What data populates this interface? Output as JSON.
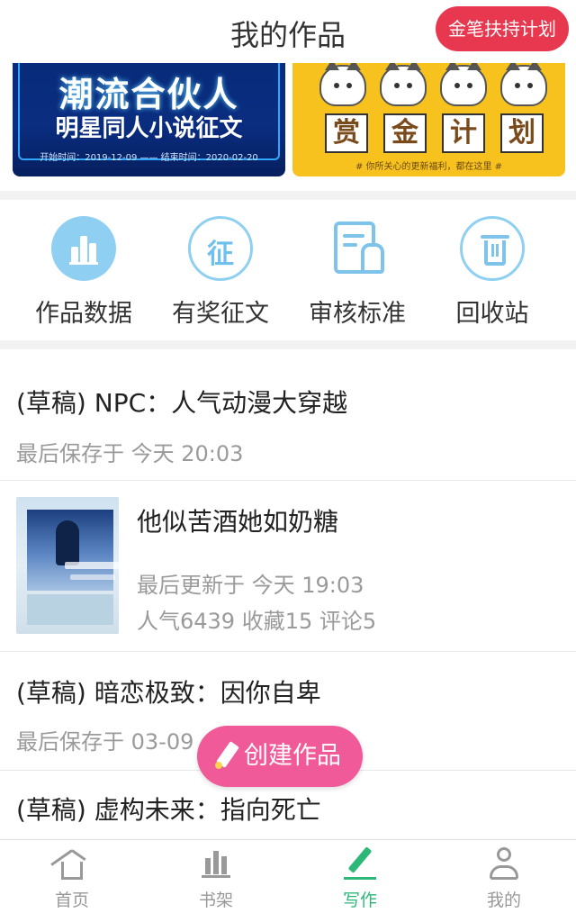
{
  "header": {
    "title": "我的作品",
    "jinbi_label": "金笔扶持计划"
  },
  "banners": [
    {
      "title": "潮流合伙人",
      "subtitle": "明星同人小说征文",
      "dates": "开始时间：2019-12-09 —— 结束时间：2020-02-20"
    },
    {
      "chars": [
        "赏",
        "金",
        "计",
        "划"
      ],
      "subtitle": "# 你所关心的更新福利，都在这里 #"
    }
  ],
  "quick": [
    {
      "label": "作品数据",
      "icon": "bar-chart-icon"
    },
    {
      "label": "有奖征文",
      "icon": "contest-icon",
      "glyph": "征"
    },
    {
      "label": "审核标准",
      "icon": "review-standard-icon"
    },
    {
      "label": "回收站",
      "icon": "trash-icon"
    }
  ],
  "works": [
    {
      "title": "(草稿) NPC：人气动漫大穿越",
      "meta": "最后保存于 今天 20:03"
    },
    {
      "title": "他似苦酒她如奶糖",
      "meta": "最后更新于 今天 19:03",
      "stats": "人气6439 收藏15 评论5"
    },
    {
      "title": "(草稿) 暗恋极致：因你自卑",
      "meta": "最后保存于 03-09"
    },
    {
      "title": "(草稿) 虚构未来：指向死亡"
    }
  ],
  "create_label": "创建作品",
  "tabs": [
    {
      "label": "首页",
      "icon": "home-icon"
    },
    {
      "label": "书架",
      "icon": "bookshelf-icon"
    },
    {
      "label": "写作",
      "icon": "write-icon"
    },
    {
      "label": "我的",
      "icon": "profile-icon"
    }
  ],
  "colors": {
    "accent_green": "#2eb878",
    "create_pink": "#f05a98",
    "jinbi_red": "#e8384f",
    "icon_blue": "#8fd0f2"
  }
}
